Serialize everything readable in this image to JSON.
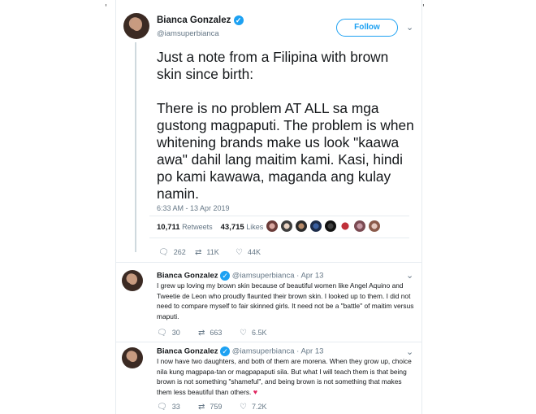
{
  "main_tweet": {
    "author_name": "Bianca Gonzalez",
    "handle": "@iamsuperbianca",
    "follow_label": "Follow",
    "text": "Just a note from a Filipina with brown skin since birth:\n\nThere is no problem AT ALL sa mga gustong magpaputi. The problem is when whitening brands make us look \"kaawa awa\" dahil lang maitim kami. Kasi, hindi po kami kawawa, maganda ang kulay namin.",
    "timestamp": "6:33 AM - 13 Apr 2019",
    "retweets_count": "10,711",
    "retweets_label": "Retweets",
    "likes_count": "43,715",
    "likes_label": "Likes",
    "replies": "262",
    "retweets_short": "11K",
    "likes_short": "44K"
  },
  "thread": [
    {
      "author_name": "Bianca Gonzalez",
      "handle": "@iamsuperbianca",
      "date": "Apr 13",
      "text": "I grew up loving my brown skin because of beautiful women like Angel Aquino and Tweetie de Leon who proudly flaunted their brown skin. I looked up to them. I did not need to compare myself to fair skinned girls. It need not be a \"battle\" of maitim versus maputi.",
      "replies": "30",
      "retweets": "663",
      "likes": "6.5K"
    },
    {
      "author_name": "Bianca Gonzalez",
      "handle": "@iamsuperbianca",
      "date": "Apr 13",
      "text": "I now have two daughters, and both of them are morena. When they grow up, choice nila kung magpapa-tan or magpapaputi sila. But what I will teach them is that being brown is not something \"shameful\", and being brown is not something that makes them less beautiful than others.",
      "replies": "33",
      "retweets": "759",
      "likes": "7.2K"
    }
  ],
  "icons": {
    "verified": "verified-badge-icon",
    "reply": "reply-icon",
    "retweet": "retweet-icon",
    "like": "heart-icon",
    "chevron": "chevron-down-icon"
  },
  "colors": {
    "accent": "#1da1f2",
    "muted": "#657786",
    "heart": "#e0245e"
  }
}
